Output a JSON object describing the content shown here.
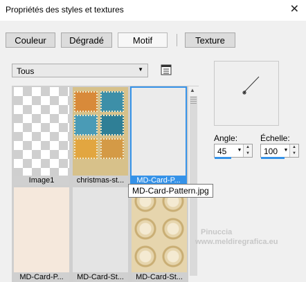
{
  "window": {
    "title": "Propriétés des styles et textures",
    "close_label": "✕"
  },
  "tabs": [
    {
      "label": "Couleur",
      "active": false
    },
    {
      "label": "Dégradé",
      "active": false
    },
    {
      "label": "Motif",
      "active": true
    },
    {
      "label": "Texture",
      "active": false
    }
  ],
  "category_dropdown": {
    "value": "Tous"
  },
  "thumbnails": [
    {
      "label": "Image1",
      "selected": false
    },
    {
      "label": "christmas-st...",
      "selected": false
    },
    {
      "label": "MD-Card-P...",
      "selected": true
    },
    {
      "label": "MD-Card-P...",
      "selected": false
    },
    {
      "label": "MD-Card-St...",
      "selected": false
    },
    {
      "label": "MD-Card-St...",
      "selected": false
    }
  ],
  "tooltip": "MD-Card-Pattern.jpg",
  "controls": {
    "angle_label": "Angle:",
    "angle_value": "45",
    "scale_label": "Échelle:",
    "scale_value": "100"
  },
  "watermark": {
    "name": "Pinuccia",
    "site": "www.meldiregrafica.eu"
  },
  "colors": {
    "selection": "#3592e8",
    "background": "#f0f0f0"
  }
}
